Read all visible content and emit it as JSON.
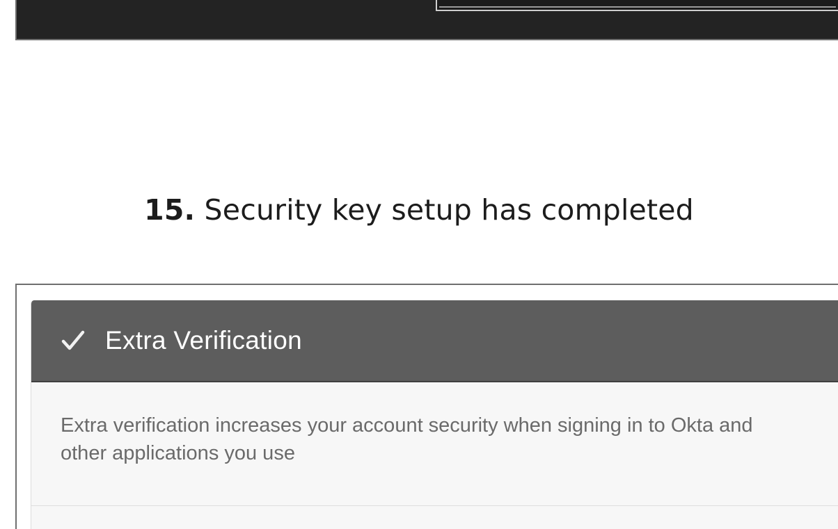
{
  "step": {
    "number": "15.",
    "text": " Security key setup has completed"
  },
  "card": {
    "icon": "checkmark-icon",
    "title": "Extra Verification",
    "description": "Extra verification increases your account security when signing in to Okta and other applications you use"
  },
  "colors": {
    "top_panel": "#232323",
    "card_header": "#5d5d5d",
    "card_body": "#f7f7f7",
    "description_text": "#6a6a6a"
  }
}
